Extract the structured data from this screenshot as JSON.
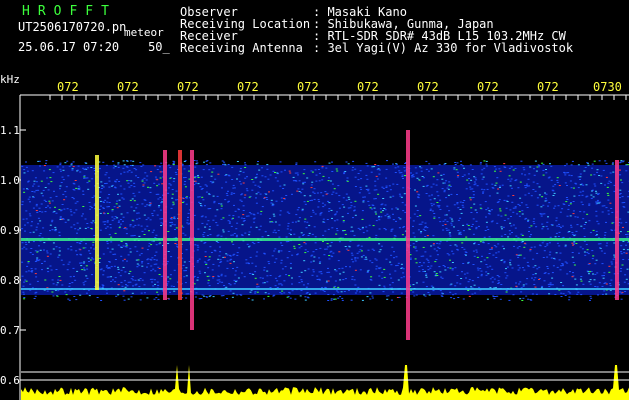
{
  "header": {
    "title": "HROFFT",
    "filename": "UT2506170720.pn",
    "meteor_label": "meteor",
    "date": "25.06.17",
    "time": "07:20",
    "interval": "50_"
  },
  "info": {
    "observer_label": "Observer",
    "observer_value": ": Masaki Kano",
    "location_label": "Receiving Location",
    "location_value": ": Shibukawa, Gunma, Japan",
    "receiver_label": "Receiver",
    "receiver_value": ": RTL-SDR SDR# 43dB L15 103.2MHz CW",
    "antenna_label": "Receiving Antenna",
    "antenna_value": ": 3el Yagi(V) Az 330 for Vladivostok"
  },
  "axis": {
    "unit": "kHz",
    "y_ticks": [
      "1.1",
      "1.0",
      "0.9",
      "0.8",
      "0.7",
      "0.6"
    ],
    "x_ticks": [
      "072",
      "072",
      "072",
      "072",
      "072",
      "072",
      "072",
      "072",
      "072",
      "0730"
    ]
  },
  "colors": {
    "background": "#000000",
    "header_title": "#3cff3c",
    "tick_text": "#ffff3c",
    "spectrum": "#ffff00",
    "noise": "#0a3cff"
  }
}
